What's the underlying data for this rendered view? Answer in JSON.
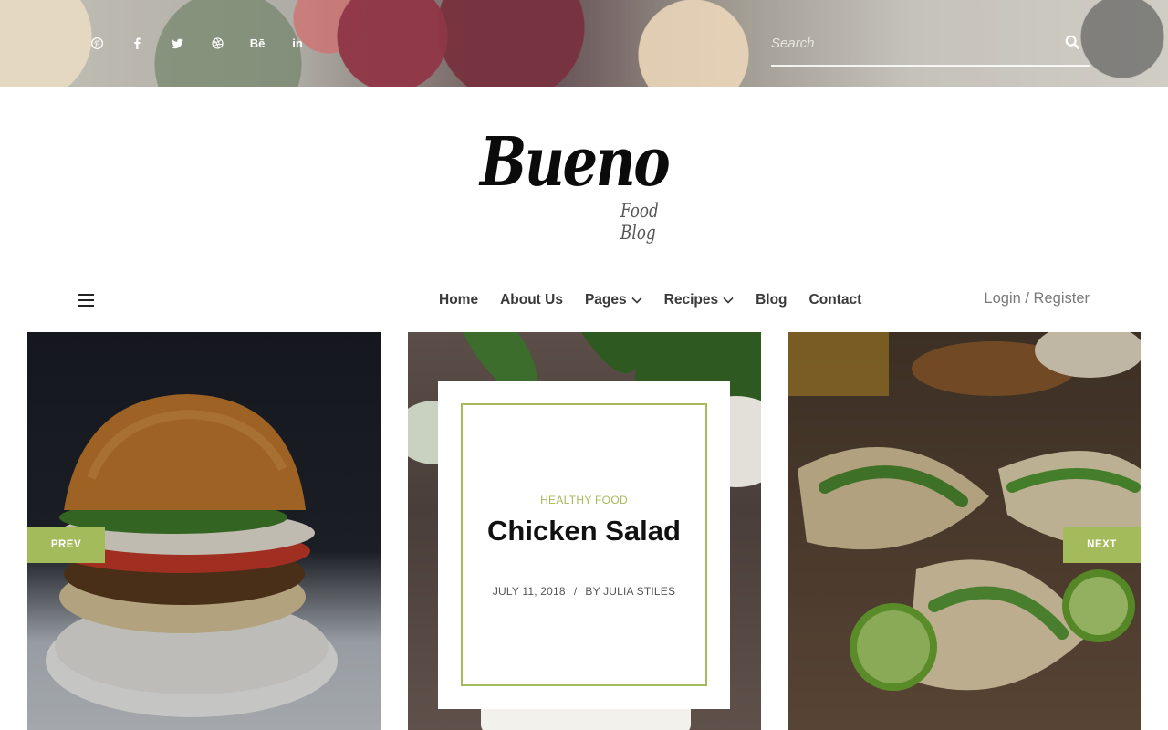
{
  "topbar": {
    "social_icons": [
      "pinterest-icon",
      "facebook-icon",
      "twitter-icon",
      "dribbble-icon",
      "behance-icon",
      "linkedin-icon"
    ],
    "behance_text": "Bē",
    "linkedin_text": "in",
    "search": {
      "placeholder": "Search"
    }
  },
  "logo": {
    "name": "Bueno",
    "tagline": "Food Blog"
  },
  "nav": {
    "items": [
      {
        "label": "Home",
        "has_dropdown": false
      },
      {
        "label": "About Us",
        "has_dropdown": false
      },
      {
        "label": "Pages",
        "has_dropdown": true
      },
      {
        "label": "Recipes",
        "has_dropdown": true
      },
      {
        "label": "Blog",
        "has_dropdown": false
      },
      {
        "label": "Contact",
        "has_dropdown": false
      }
    ],
    "login_label": "Login / Register"
  },
  "slider": {
    "prev_label": "PREV",
    "next_label": "NEXT",
    "featured": {
      "category": "HEALTHY FOOD",
      "title": "Chicken Salad",
      "date": "JULY 11, 2018",
      "separator": "/",
      "author": "BY JULIA STILES"
    }
  },
  "colors": {
    "accent": "#a4bb5b",
    "text_dark": "#111111",
    "nav_text": "#3a3a3a"
  }
}
